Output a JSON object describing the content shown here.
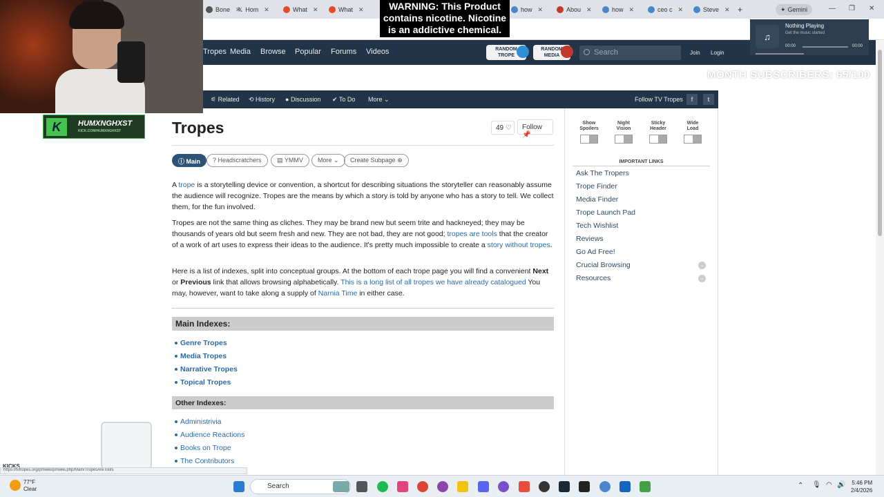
{
  "browser": {
    "tabs": [
      {
        "label": "Bone",
        "color": "#555"
      },
      {
        "label": "Hom",
        "color": "#000"
      },
      {
        "label": "What",
        "color": "#e34b2b"
      },
      {
        "label": "What",
        "color": "#e34b2b"
      },
      {
        "label": "how",
        "color": "#4a86c8"
      },
      {
        "label": "Abou",
        "color": "#c0392b"
      },
      {
        "label": "how",
        "color": "#4a86c8"
      },
      {
        "label": "ceo c",
        "color": "#4a86c8"
      },
      {
        "label": "Steve",
        "color": "#4a86c8"
      }
    ],
    "gemini": "Gemini",
    "new_tab": "+"
  },
  "warning": {
    "text": "WARNING: This Product contains nicotine. Nicotine is an addictive chemical."
  },
  "overlay": {
    "subs": "MONTH SUBSCRIBERS: 65/100",
    "kicks": "KICKS",
    "badge_name": "HUMXNGHXST",
    "badge_sub": "KICK.COM/HUMXNGHXST",
    "status_url": "https://tvtropes.org/pmwiki/pmwiki.php/Main/TropesAreTools"
  },
  "now_playing": {
    "title": "Nothing Playing",
    "subtitle": "Get the music started",
    "time_start": "00:00",
    "time_end": "00:00",
    "progress": 0
  },
  "tv": {
    "nav": [
      "Tropes",
      "Media",
      "Browse",
      "Popular",
      "Forums",
      "Videos"
    ],
    "random_trope": "RANDOM TROPE",
    "random_media": "RANDOM MEDIA",
    "search_placeholder": "Search",
    "join": "Join",
    "login": "Login",
    "toolbar": {
      "related": "Related",
      "history": "History",
      "discussion": "Discussion",
      "todo": "To Do",
      "more": "More",
      "follow_label": "Follow TV Tropes"
    }
  },
  "article": {
    "title": "Tropes",
    "count": "49",
    "follow": "Follow",
    "pills": [
      "Main",
      "Headscratchers",
      "YMMV",
      "More",
      "Create Subpage"
    ],
    "p1_a": "A ",
    "p1_link": "trope",
    "p1_b": " is a storytelling device or convention, a shortcut for describing situations the storyteller can reasonably assume the audience will recognize. Tropes are the means by which a story is told by anyone who has a story to tell. We collect them, for the fun involved.",
    "p2_a": "Tropes are not the same thing as cliches. They may be brand new but seem trite and hackneyed; they may be thousands of years old but seem fresh and new. They are not bad, they are not good; ",
    "p2_link1": "tropes are tools",
    "p2_b": " that the creator of a work of art uses to express their ideas to the audience. It's pretty much impossible to create a ",
    "p2_link2": "story without tropes",
    "p2_c": ".",
    "p3_a": "Here is a list of indexes, split into conceptual groups. At the bottom of each trope page you will find a convenient ",
    "p3_next": "Next",
    "p3_or": " or ",
    "p3_prev": "Previous",
    "p3_b": " link that allows browsing alphabetically. ",
    "p3_link1": "This is a long list of all tropes we have already catalogued",
    "p3_c": " You may, however, want to take along a supply of ",
    "p3_link2": "Narnia Time",
    "p3_d": " in either case.",
    "main_idx": "Main Indexes:",
    "main_items": [
      "Genre Tropes",
      "Media Tropes",
      "Narrative Tropes",
      "Topical Tropes"
    ],
    "other_idx": "Other Indexes:",
    "other_items": [
      "Administrivia",
      "Audience Reactions",
      "Books on Trope",
      "The Contributors"
    ]
  },
  "sidebar": {
    "toggles": [
      {
        "l1": "Show",
        "l2": "Spoilers"
      },
      {
        "l1": "Night",
        "l2": "Vision"
      },
      {
        "l1": "Sticky",
        "l2": "Header"
      },
      {
        "l1": "Wide",
        "l2": "Load"
      }
    ],
    "important": "IMPORTANT LINKS",
    "links": [
      "Ask The Tropers",
      "Trope Finder",
      "Media Finder",
      "Trope Launch Pad",
      "Tech Wishlist",
      "Reviews",
      "Go Ad Free!",
      "Crucial Browsing",
      "Resources"
    ]
  },
  "taskbar": {
    "temp": "77°F",
    "weather": "Clear",
    "search": "Search",
    "time": "5:46 PM",
    "date": "2/4/2026"
  },
  "colors": {
    "navy": "#213448",
    "link": "#2a6aa6"
  }
}
